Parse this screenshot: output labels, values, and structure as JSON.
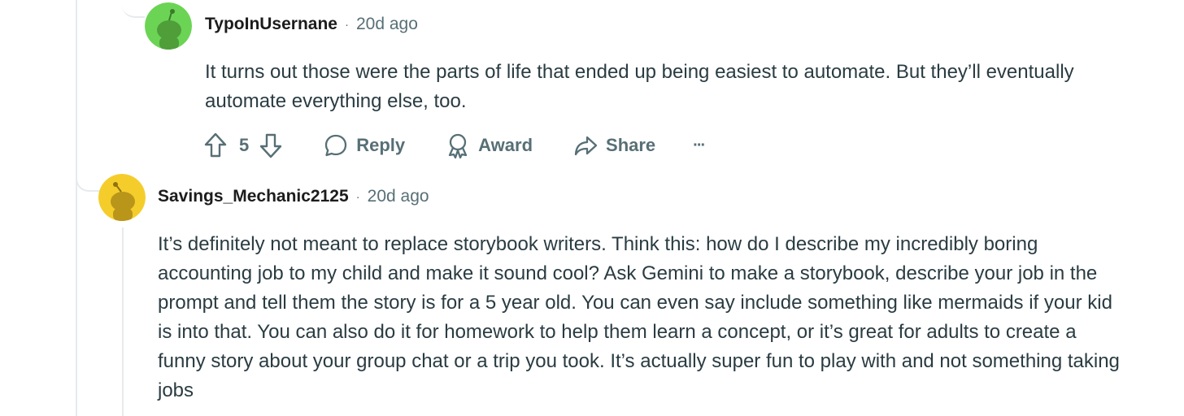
{
  "comments": [
    {
      "username": "TypoInUsernane",
      "separator": "·",
      "time": "20d ago",
      "avatar_color": "#6cd455",
      "text": "It turns out those were the parts of life that ended up being easiest to automate. But they’ll eventually automate everything else, too.",
      "actions": {
        "upvote_icon": "arrow-up-icon",
        "score": "5",
        "downvote_icon": "arrow-down-icon",
        "reply": "Reply",
        "award": "Award",
        "share": "Share",
        "more": "···"
      }
    },
    {
      "username": "Savings_Mechanic2125",
      "separator": "·",
      "time": "20d ago",
      "avatar_color": "#f5cd2b",
      "text": "It’s definitely not meant to replace storybook writers. Think this: how do I describe my incredibly boring accounting job to my child and make it sound cool? Ask Gemini to make a storybook, describe your job in the prompt and tell them the story is for a 5 year old. You can even say include something like mermaids if your kid is into that. You can also do it for homework to help them learn a concept, or it’s great for adults to create a funny story about your group chat or a trip you took. It’s actually super fun to play with and not something taking jobs"
    }
  ]
}
